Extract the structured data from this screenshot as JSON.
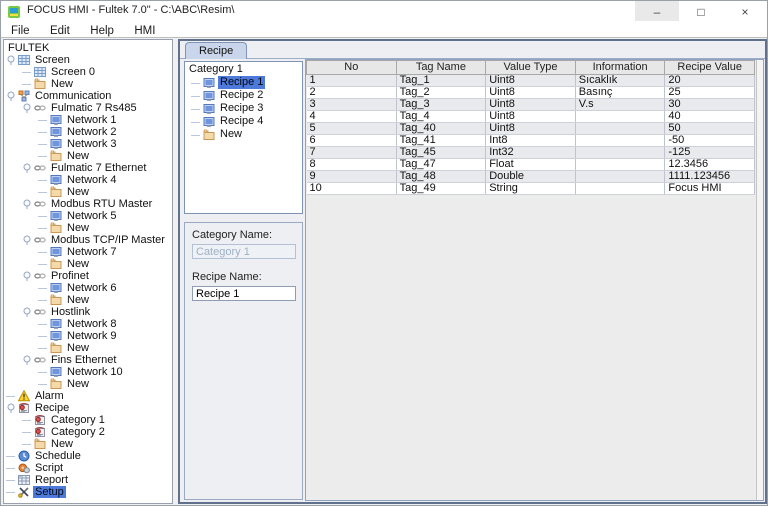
{
  "window": {
    "title": "FOCUS HMI - Fultek 7.0\" - C:\\ABC\\Resim\\",
    "controls": {
      "minimize": "–",
      "maximize": "□",
      "close": "×"
    }
  },
  "menubar": {
    "items": [
      "File",
      "Edit",
      "Help",
      "HMI"
    ]
  },
  "colors": {
    "selection_blue": "#4d79da",
    "panel_border_blue": "#61718c",
    "tab_background": "#c9d5ea",
    "warning_yellow": "#ffd42a",
    "row_stripe_gray": "#e9eaed"
  },
  "project_tree": {
    "items": [
      {
        "label": "FULTEK",
        "depth": 0,
        "icon": "",
        "handle": false,
        "selected": false
      },
      {
        "label": "Screen",
        "depth": 1,
        "icon": "screen",
        "handle": true,
        "selected": false
      },
      {
        "label": "Screen 0",
        "depth": 2,
        "icon": "screen",
        "handle": false,
        "selected": false
      },
      {
        "label": "New",
        "depth": 2,
        "icon": "folder",
        "handle": false,
        "selected": false
      },
      {
        "label": "Communication",
        "depth": 1,
        "icon": "comm",
        "handle": true,
        "selected": false
      },
      {
        "label": "Fulmatic 7 Rs485",
        "depth": 2,
        "icon": "link",
        "handle": true,
        "selected": false
      },
      {
        "label": "Network 1",
        "depth": 3,
        "icon": "network",
        "handle": false,
        "selected": false
      },
      {
        "label": "Network 2",
        "depth": 3,
        "icon": "network",
        "handle": false,
        "selected": false
      },
      {
        "label": "Network 3",
        "depth": 3,
        "icon": "network",
        "handle": false,
        "selected": false
      },
      {
        "label": "New",
        "depth": 3,
        "icon": "folder",
        "handle": false,
        "selected": false
      },
      {
        "label": "Fulmatic 7 Ethernet",
        "depth": 2,
        "icon": "link",
        "handle": true,
        "selected": false
      },
      {
        "label": "Network 4",
        "depth": 3,
        "icon": "network",
        "handle": false,
        "selected": false
      },
      {
        "label": "New",
        "depth": 3,
        "icon": "folder",
        "handle": false,
        "selected": false
      },
      {
        "label": "Modbus RTU Master",
        "depth": 2,
        "icon": "link",
        "handle": true,
        "selected": false
      },
      {
        "label": "Network 5",
        "depth": 3,
        "icon": "network",
        "handle": false,
        "selected": false
      },
      {
        "label": "New",
        "depth": 3,
        "icon": "folder",
        "handle": false,
        "selected": false
      },
      {
        "label": "Modbus TCP/IP Master",
        "depth": 2,
        "icon": "link",
        "handle": true,
        "selected": false
      },
      {
        "label": "Network 7",
        "depth": 3,
        "icon": "network",
        "handle": false,
        "selected": false
      },
      {
        "label": "New",
        "depth": 3,
        "icon": "folder",
        "handle": false,
        "selected": false
      },
      {
        "label": "Profinet",
        "depth": 2,
        "icon": "link",
        "handle": true,
        "selected": false
      },
      {
        "label": "Network 6",
        "depth": 3,
        "icon": "network",
        "handle": false,
        "selected": false
      },
      {
        "label": "New",
        "depth": 3,
        "icon": "folder",
        "handle": false,
        "selected": false
      },
      {
        "label": "Hostlink",
        "depth": 2,
        "icon": "link",
        "handle": true,
        "selected": false
      },
      {
        "label": "Network 8",
        "depth": 3,
        "icon": "network",
        "handle": false,
        "selected": false
      },
      {
        "label": "Network 9",
        "depth": 3,
        "icon": "network",
        "handle": false,
        "selected": false
      },
      {
        "label": "New",
        "depth": 3,
        "icon": "folder",
        "handle": false,
        "selected": false
      },
      {
        "label": "Fins Ethernet",
        "depth": 2,
        "icon": "link",
        "handle": true,
        "selected": false
      },
      {
        "label": "Network 10",
        "depth": 3,
        "icon": "network",
        "handle": false,
        "selected": false
      },
      {
        "label": "New",
        "depth": 3,
        "icon": "folder",
        "handle": false,
        "selected": false
      },
      {
        "label": "Alarm",
        "depth": 1,
        "icon": "warning",
        "handle": false,
        "selected": false
      },
      {
        "label": "Recipe",
        "depth": 1,
        "icon": "recipe",
        "handle": true,
        "selected": false
      },
      {
        "label": "Category 1",
        "depth": 2,
        "icon": "recipe",
        "handle": false,
        "selected": false
      },
      {
        "label": "Category 2",
        "depth": 2,
        "icon": "recipe",
        "handle": false,
        "selected": false
      },
      {
        "label": "New",
        "depth": 2,
        "icon": "folder",
        "handle": false,
        "selected": false
      },
      {
        "label": "Schedule",
        "depth": 1,
        "icon": "clock",
        "handle": false,
        "selected": false
      },
      {
        "label": "Script",
        "depth": 1,
        "icon": "script",
        "handle": false,
        "selected": false
      },
      {
        "label": "Report",
        "depth": 1,
        "icon": "report",
        "handle": false,
        "selected": false
      },
      {
        "label": "Setup",
        "depth": 1,
        "icon": "setup",
        "handle": false,
        "selected": true
      }
    ]
  },
  "main": {
    "tab": {
      "label": "Recipe"
    },
    "category_tree": {
      "root": "Category 1",
      "items": [
        {
          "label": "Recipe 1",
          "icon": "network",
          "selected": true
        },
        {
          "label": "Recipe 2",
          "icon": "network",
          "selected": false
        },
        {
          "label": "Recipe 3",
          "icon": "network",
          "selected": false
        },
        {
          "label": "Recipe 4",
          "icon": "network",
          "selected": false
        },
        {
          "label": "New",
          "icon": "folder",
          "selected": false
        }
      ]
    },
    "form": {
      "category_label": "Category Name:",
      "category_value": "Category 1",
      "recipe_label": "Recipe Name:",
      "recipe_value": "Recipe 1"
    },
    "table": {
      "columns": [
        "No",
        "Tag Name",
        "Value Type",
        "Information",
        "Recipe Value"
      ],
      "rows": [
        [
          "1",
          "Tag_1",
          "Uint8",
          "Sıcaklık",
          "20"
        ],
        [
          "2",
          "Tag_2",
          "Uint8",
          "Basınç",
          "25"
        ],
        [
          "3",
          "Tag_3",
          "Uint8",
          "V.s",
          "30"
        ],
        [
          "4",
          "Tag_4",
          "Uint8",
          "",
          "40"
        ],
        [
          "5",
          "Tag_40",
          "Uint8",
          "",
          "50"
        ],
        [
          "6",
          "Tag_41",
          "Int8",
          "",
          "-50"
        ],
        [
          "7",
          "Tag_45",
          "Int32",
          "",
          "-125"
        ],
        [
          "8",
          "Tag_47",
          "Float",
          "",
          "12.3456"
        ],
        [
          "9",
          "Tag_48",
          "Double",
          "",
          "1111.123456"
        ],
        [
          "10",
          "Tag_49",
          "String",
          "",
          "Focus HMI"
        ]
      ]
    }
  }
}
